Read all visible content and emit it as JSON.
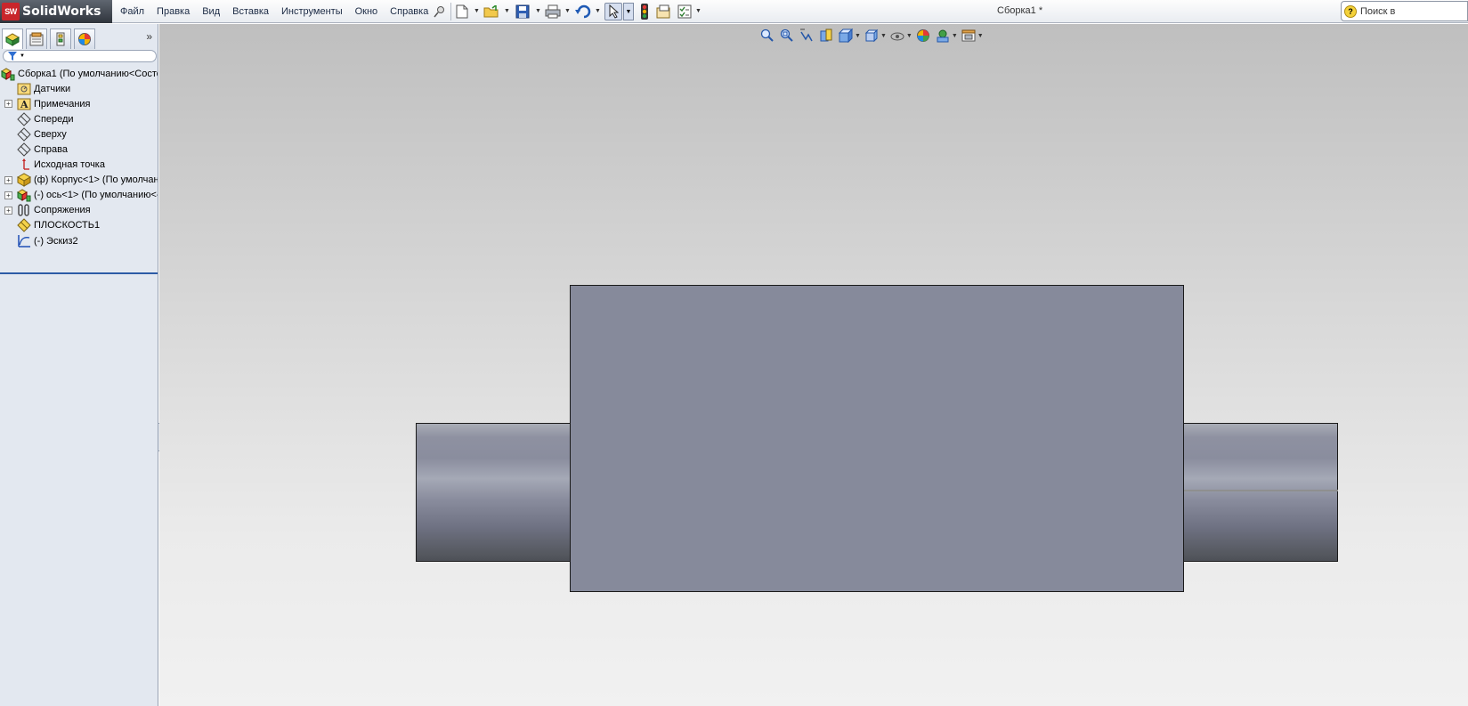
{
  "app": {
    "logo_badge": "SW",
    "logo_text": "SolidWorks",
    "document_title": "Сборка1 *"
  },
  "menu": {
    "items": [
      "Файл",
      "Правка",
      "Вид",
      "Вставка",
      "Инструменты",
      "Окно",
      "Справка"
    ]
  },
  "toolbar": {
    "icons": [
      "pin-icon",
      "new-document-icon",
      "open-folder-icon",
      "save-icon",
      "print-icon",
      "undo-icon",
      "select-arrow-icon",
      "rebuild-traffic-light-icon",
      "file-properties-icon",
      "options-icon"
    ]
  },
  "search": {
    "placeholder": "Поиск в"
  },
  "panel": {
    "tabs": [
      "feature-manager-icon",
      "property-manager-icon",
      "configuration-manager-icon",
      "display-manager-icon"
    ],
    "collapse_glyph": "»"
  },
  "tree": {
    "items": [
      {
        "label": "Сборка1  (По умолчанию<Состо",
        "icon": "assembly-icon",
        "expandable": false,
        "level": 0
      },
      {
        "label": "Датчики",
        "icon": "sensors-icon",
        "expandable": false,
        "level": 1
      },
      {
        "label": "Примечания",
        "icon": "annotations-icon",
        "expandable": true,
        "level": 1
      },
      {
        "label": "Спереди",
        "icon": "plane-icon",
        "expandable": false,
        "level": 1
      },
      {
        "label": "Сверху",
        "icon": "plane-icon",
        "expandable": false,
        "level": 1
      },
      {
        "label": "Справа",
        "icon": "plane-icon",
        "expandable": false,
        "level": 1
      },
      {
        "label": "Исходная точка",
        "icon": "origin-icon",
        "expandable": false,
        "level": 1
      },
      {
        "label": "(ф) Корпус<1> (По умолчани",
        "icon": "part-icon",
        "expandable": true,
        "level": 1
      },
      {
        "label": "(-) ось<1> (По умолчанию<-",
        "icon": "subassembly-icon",
        "expandable": true,
        "level": 1
      },
      {
        "label": "Сопряжения",
        "icon": "mates-icon",
        "expandable": true,
        "level": 1
      },
      {
        "label": "ПЛОСКОСТЬ1",
        "icon": "ref-plane-icon",
        "expandable": false,
        "level": 1
      },
      {
        "label": "(-) Эскиз2",
        "icon": "sketch-icon",
        "expandable": false,
        "level": 1
      }
    ]
  },
  "view_toolbar": {
    "icons": [
      "zoom-to-fit-icon",
      "zoom-area-icon",
      "previous-view-icon",
      "section-view-icon",
      "view-orientation-icon",
      "display-style-icon",
      "hide-show-items-icon",
      "edit-appearance-icon",
      "apply-scene-icon",
      "view-settings-icon"
    ]
  },
  "colors": {
    "housing": "#868a9b",
    "shaft": "#8e91a1",
    "viewport_top": "#bfbfbf",
    "viewport_bottom": "#f1f1f1",
    "panel_bg": "#e3e8f0"
  }
}
